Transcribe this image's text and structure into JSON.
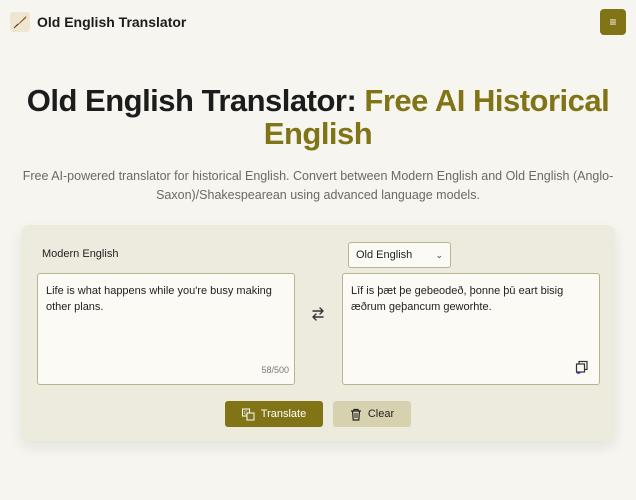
{
  "header": {
    "brand": "Old English Translator",
    "logo_icon": "quill-icon",
    "menu_icon": "≡"
  },
  "hero": {
    "title_part1": "Old English Translator: ",
    "title_part2": "Free AI Historical English",
    "subtitle": "Free AI-powered translator for historical English. Convert between Modern English and Old English (Anglo-Saxon)/Shakespearean using advanced language models."
  },
  "translator": {
    "source_label": "Modern English",
    "target_select": "Old English",
    "source_text": "Life is what happens while you're busy making other plans.",
    "char_count": "58/500",
    "output_text": "Līf is þæt þe gebeodeð, þonne þū eart bisig æðrum geþancum geworhte.",
    "translate_label": "Translate",
    "clear_label": "Clear"
  },
  "colors": {
    "accent": "#807417",
    "background": "#f6f5ef",
    "card": "#edeade"
  }
}
